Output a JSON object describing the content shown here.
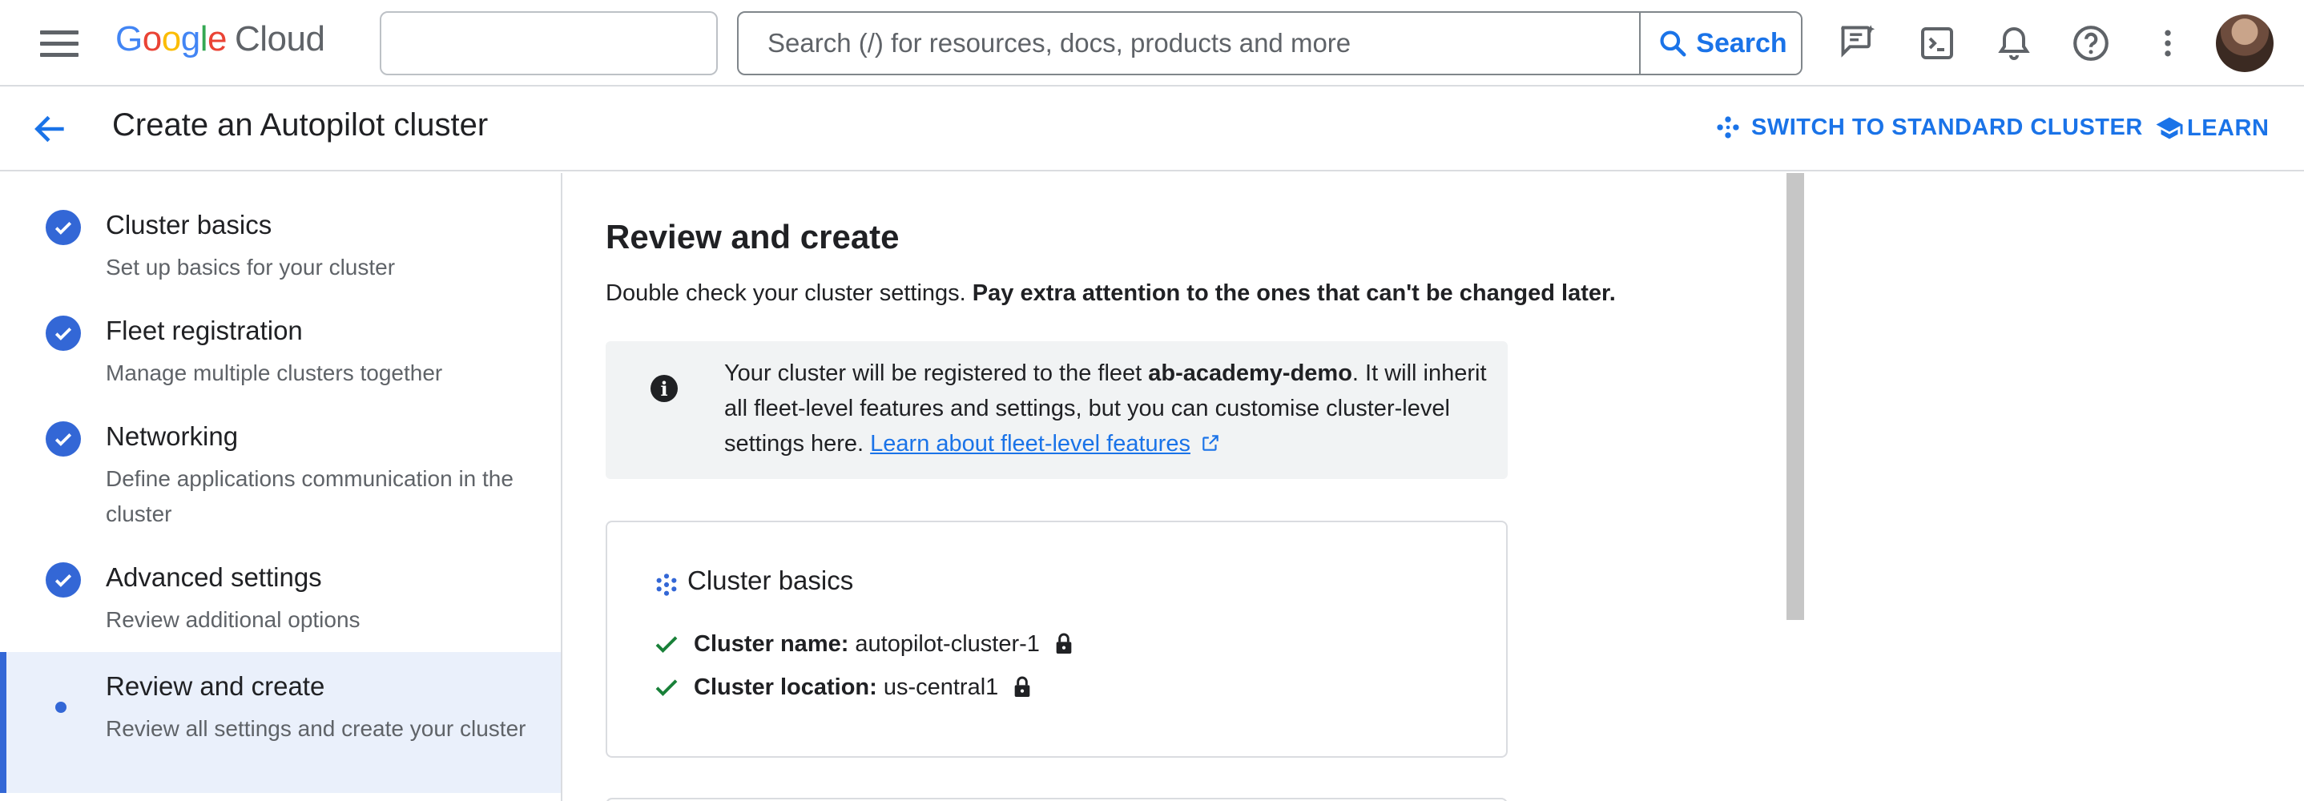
{
  "topbar": {
    "logo": {
      "g1": "G",
      "g2": "o",
      "g3": "o",
      "g4": "g",
      "g5": "l",
      "g6": "e",
      "product": "Cloud"
    },
    "project_picker_value": "",
    "search_placeholder": "Search (/) for resources, docs, products and more",
    "search_button_label": "Search",
    "icons": [
      "menu-icon",
      "feedback-icon",
      "cloud-shell-icon",
      "notifications-icon",
      "help-icon",
      "more-vert-icon"
    ]
  },
  "subheader": {
    "page_title": "Create an Autopilot cluster",
    "switch_label": "SWITCH TO STANDARD CLUSTER",
    "learn_label": "LEARN"
  },
  "steps": [
    {
      "title": "Cluster basics",
      "description": "Set up basics for your cluster",
      "state": "complete"
    },
    {
      "title": "Fleet registration",
      "description": "Manage multiple clusters together",
      "state": "complete"
    },
    {
      "title": "Networking",
      "description": "Define applications communication in the cluster",
      "state": "complete"
    },
    {
      "title": "Advanced settings",
      "description": "Review additional options",
      "state": "complete"
    },
    {
      "title": "Review and create",
      "description": "Review all settings and create your cluster",
      "state": "active"
    }
  ],
  "main": {
    "title": "Review and create",
    "intro_plain": "Double check your cluster settings. ",
    "intro_bold": "Pay extra attention to the ones that can't be changed later.",
    "info": {
      "text_before": "Your cluster will be registered to the fleet ",
      "fleet_name": "ab-academy-demo",
      "text_after": ". It will inherit all fleet-level features and settings, but you can customise cluster-level settings here. ",
      "link_label": "Learn about fleet-level features"
    },
    "card": {
      "title": "Cluster basics",
      "rows": [
        {
          "label": "Cluster name:",
          "value": "autopilot-cluster-1"
        },
        {
          "label": "Cluster location:",
          "value": "us-central1"
        }
      ]
    }
  },
  "colors": {
    "accent": "#1a73e8",
    "check": "#3367d6",
    "success": "#188038",
    "active_bg": "#eaf0fb"
  }
}
